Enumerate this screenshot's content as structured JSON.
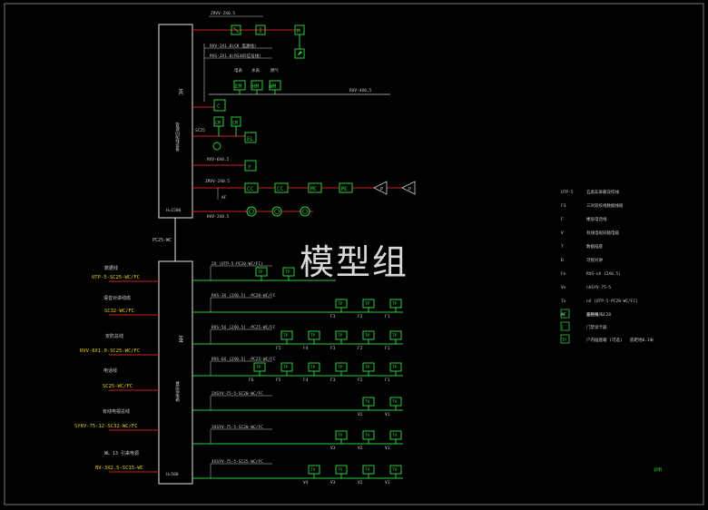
{
  "watermark": "模型组",
  "upper_cabinet": {
    "vertical_label": "HC",
    "small_label": "管理间配线设备",
    "height_label": "H=1500"
  },
  "lower_cabinet": {
    "vertical_label": "HM",
    "small_label": "楼层弱电箱",
    "height_label": "H=500"
  },
  "pipe_label": "PC25-WC",
  "upper_circuits": {
    "r1_cable": "ZRVV-2X0.5",
    "r2_cable": "RVV-2X1.0(CK 电源线)",
    "r3_cable": "RVS-2X1.0(RS485信号线)",
    "col_labels": [
      "电表",
      "水表",
      "燃气"
    ],
    "em": "EM",
    "hm": "HM",
    "wm": "WM",
    "c": "C",
    "m": "M",
    "rvv4": "RVV-4X0.5",
    "sc25": "SC25",
    "cm1": "CM",
    "cm2": "CM",
    "el": "EL",
    "y": "Y",
    "rvv6": "RVV-6X0.5",
    "zrvv2": "ZRVV-2X0.5",
    "af": "AF",
    "cc": "CC",
    "cc2": "CC",
    "mc": "MC",
    "mc2": "MC",
    "p1": "P",
    "p2": "P",
    "rvv2": "RVV-2X0.5"
  },
  "lower_circuits": [
    {
      "cable": "2X (UTP-5-PC20-WC/FC)",
      "labels": [],
      "tps": [
        "TP",
        "TP"
      ]
    },
    {
      "cable": "RVS-3X (2X0.5) -PC20-WC/FC",
      "labels": [
        "F3",
        "F2",
        "F1"
      ],
      "tps": [
        "TP",
        "TP",
        "TP"
      ]
    },
    {
      "cable": "RVS-5X (2X0.5) -PC25-WC/FC",
      "labels": [
        "F5",
        "F4",
        "F3",
        "F2",
        "F1"
      ],
      "tps": [
        "TP",
        "TP",
        "TP",
        "TP",
        "TP"
      ]
    },
    {
      "cable": "RVS-6X (2X0.5) -PC25-WC/FC",
      "labels": [
        "F6",
        "F5",
        "F4",
        "F3",
        "F2",
        "F1"
      ],
      "tps": [
        "TP",
        "TP",
        "TP",
        "TP",
        "TP",
        "TP"
      ]
    },
    {
      "cable": "2XSYV-75-5-SC20-WC/FC",
      "labels": [
        "V2",
        "V1"
      ],
      "tps": [
        "TV",
        "TV"
      ]
    },
    {
      "cable": "3XSYV-75-5-SC20-WC/FC",
      "labels": [
        "V3",
        "V2",
        "V1"
      ],
      "tps": [
        "TV",
        "TV",
        "TV"
      ]
    },
    {
      "cable": "4XSYV-75-5-SC25-WC/FC",
      "labels": [
        "V4",
        "V3",
        "V2",
        "V1"
      ],
      "tps": [
        "TV",
        "TV",
        "TV",
        "TV"
      ]
    }
  ],
  "left_feeds": [
    {
      "title": "数据线",
      "spec": "UTP-5-SC25-WC/FC"
    },
    {
      "title": "语音对讲线缆",
      "spec": "SC32-WC/FC"
    },
    {
      "title": "安防总线",
      "spec": "RVV-6X1.0-SC25-WC/FC"
    },
    {
      "title": "电话线",
      "spec": "SC25-WC/FC"
    },
    {
      "title": "有线电视总线",
      "spec": "SYKV-75-12-SC32-WC/FC"
    },
    {
      "title": "WL 13 引来电源",
      "spec": "BV-3X2.5-SC15-WC"
    }
  ],
  "legend": [
    {
      "key": "UTP-5",
      "desc": "五类非屏蔽双绞线"
    },
    {
      "key": "F3",
      "desc": "三对双绞线数据线缆"
    },
    {
      "key": "F",
      "desc": "楼层电话线"
    },
    {
      "key": "V",
      "desc": "有线电视同轴电缆"
    },
    {
      "key": "T",
      "desc": "数据插座"
    },
    {
      "key": "D",
      "desc": "可视对讲"
    },
    {
      "key": "Fn",
      "desc": "RVS-nX (2X0.5)"
    },
    {
      "key": "Vn",
      "desc": "nXSYV-75-5"
    },
    {
      "key": "Tn",
      "desc": "nX (UTP-5-PC20-WC/FC)"
    },
    {
      "key": "AF",
      "desc": "安防线    SC20"
    }
  ],
  "legend_symbols": [
    {
      "symbol": "M",
      "desc": "监控探头"
    },
    {
      "symbol": "C",
      "desc": "门禁读卡器"
    },
    {
      "symbol": "TP",
      "desc": "户内插座箱  (可选)",
      "extra": "底距地0.3米"
    }
  ],
  "footer_mark": "说明"
}
